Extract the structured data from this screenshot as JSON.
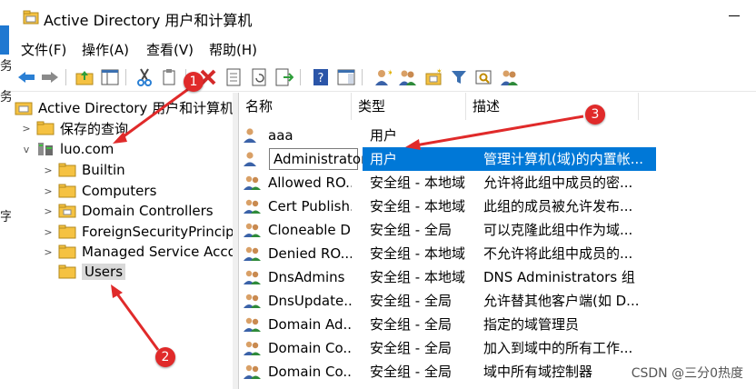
{
  "window": {
    "title": "Active Directory 用户和计算机"
  },
  "menu": [
    {
      "label": "文件(F)"
    },
    {
      "label": "操作(A)"
    },
    {
      "label": "查看(V)"
    },
    {
      "label": "帮助(H)"
    }
  ],
  "toolbar": [
    "back-icon",
    "forward-icon",
    "up-folder-icon",
    "show-console-tree-icon",
    "cut-icon",
    "copy-icon",
    "delete-icon",
    "properties-icon",
    "refresh-icon",
    "export-list-icon",
    "help-icon",
    "action-pane-icon",
    "new-user-icon",
    "new-group-icon",
    "new-ou-icon",
    "filter-icon",
    "find-icon",
    "add-to-group-icon"
  ],
  "tree": {
    "root": "Active Directory 用户和计算机 [",
    "saved_queries": "保存的查询",
    "domain": "luo.com",
    "children": [
      "Builtin",
      "Computers",
      "Domain Controllers",
      "ForeignSecurityPrincipal",
      "Managed Service Accou",
      "Users"
    ],
    "selected": "Users"
  },
  "columns": {
    "name": "名称",
    "type": "类型",
    "description": "描述"
  },
  "rows": [
    {
      "name": "aaa",
      "type": "用户",
      "description": ""
    },
    {
      "name": "Administrator",
      "type": "用户",
      "description": "管理计算机(域)的内置帐..."
    },
    {
      "name": "Allowed RO...",
      "type": "安全组 - 本地域",
      "description": "允许将此组中成员的密..."
    },
    {
      "name": "Cert Publish...",
      "type": "安全组 - 本地域",
      "description": "此组的成员被允许发布..."
    },
    {
      "name": "Cloneable D...",
      "type": "安全组 - 全局",
      "description": "可以克隆此组中作为域..."
    },
    {
      "name": "Denied RO...",
      "type": "安全组 - 本地域",
      "description": "不允许将此组中成员的..."
    },
    {
      "name": "DnsAdmins",
      "type": "安全组 - 本地域",
      "description": "DNS Administrators 组"
    },
    {
      "name": "DnsUpdate...",
      "type": "安全组 - 全局",
      "description": "允许替其他客户端(如 D..."
    },
    {
      "name": "Domain Ad...",
      "type": "安全组 - 全局",
      "description": "指定的域管理员"
    },
    {
      "name": "Domain Co...",
      "type": "安全组 - 全局",
      "description": "加入到域中的所有工作..."
    },
    {
      "name": "Domain Co...",
      "type": "安全组 - 全局",
      "description": "域中所有域控制器"
    }
  ],
  "annotations": [
    "1",
    "2",
    "3"
  ],
  "watermark": "CSDN @三分0热度",
  "edge_chars": [
    "务",
    "务",
    "字"
  ],
  "colors": {
    "selection": "#0078d7",
    "annotation": "#e02a2a",
    "folder": "#f5c242"
  }
}
